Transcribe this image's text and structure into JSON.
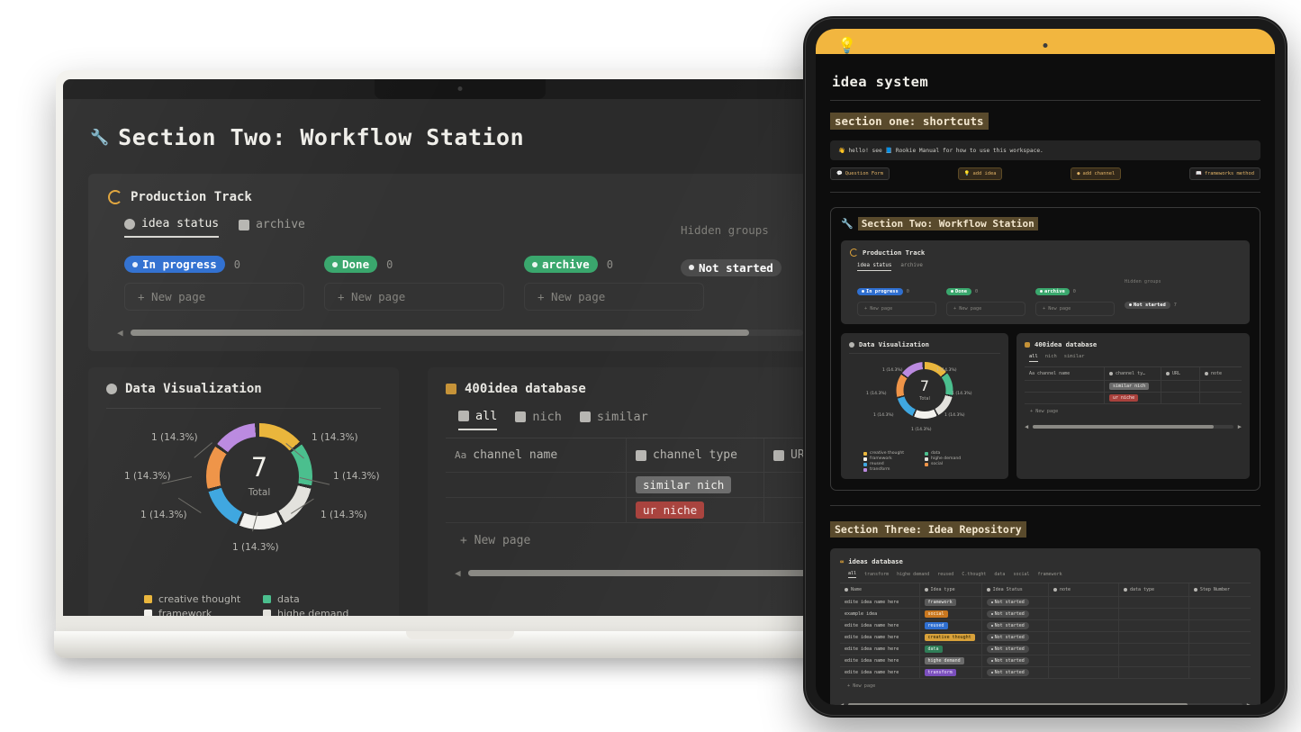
{
  "laptop": {
    "page_title": "Section Two: Workflow Station",
    "wrench_icon": "wrench-icon",
    "production": {
      "title": "Production Track",
      "tabs": [
        {
          "label": "idea status",
          "icon": "pie-icon",
          "active": true
        },
        {
          "label": "archive",
          "icon": "archive-icon",
          "active": false
        }
      ],
      "groups": [
        {
          "label": "In progress",
          "count": "0",
          "color": "#2f6fd0",
          "new_page": "+ New page"
        },
        {
          "label": "Done",
          "count": "0",
          "color": "#3aa76d",
          "new_page": "+ New page"
        },
        {
          "label": "archive",
          "count": "0",
          "color": "#3aa76d",
          "new_page": "+ New page"
        }
      ],
      "hidden_groups_label": "Hidden groups",
      "hidden_pill": {
        "label": "Not started",
        "count": "7",
        "color": "#4a4a4a"
      },
      "scroll_thumb_pct": 92
    },
    "data_viz": {
      "title": "Data Visualization",
      "icon": "clock-icon"
    },
    "database": {
      "title": "400idea database",
      "icon": "grid-yellow-icon",
      "tabs": [
        {
          "label": "all",
          "icon": "grid-icon",
          "active": true
        },
        {
          "label": "nich",
          "icon": "login-icon",
          "active": false
        },
        {
          "label": "similar",
          "icon": "logout-icon",
          "active": false
        }
      ],
      "columns": [
        {
          "label": "channel name",
          "icon": "Aa"
        },
        {
          "label": "channel type",
          "icon": "lock-icon"
        },
        {
          "label": "URL",
          "icon": "link-icon"
        },
        {
          "label": "note",
          "icon": "text-icon"
        }
      ],
      "rows": [
        {
          "name": "",
          "type": "similar nich",
          "type_bg": "#6b6b6b",
          "type_fg": "#f0efeb",
          "url": "",
          "note": ""
        },
        {
          "name": "",
          "type": "ur niche",
          "type_bg": "#a8413c",
          "type_fg": "#f6e9e8",
          "url": "",
          "note": ""
        }
      ],
      "new_page": "+ New page",
      "scroll_thumb_pct": 88
    }
  },
  "tablet": {
    "banner_icon": "lightbulb-icon",
    "h1": "idea system",
    "section_one": "section one: shortcuts",
    "callout": "hello! see 📘 Rookie Manual for how to use this workspace.",
    "callout_icon": "wave-icon",
    "buttons": [
      {
        "label": "Question Form",
        "icon": "speech-icon",
        "style": "plain"
      },
      {
        "label": "add idea",
        "icon": "bulb-icon",
        "style": "gold"
      },
      {
        "label": "add channel",
        "icon": "circle-icon",
        "style": "gold"
      },
      {
        "label": "frameworks method",
        "icon": "book-icon",
        "style": "plain"
      }
    ],
    "section_two": "Section Two: Workflow Station",
    "production": {
      "title": "Production Track",
      "tabs": [
        {
          "label": "idea status",
          "active": true
        },
        {
          "label": "archive",
          "active": false
        }
      ],
      "groups": [
        {
          "label": "In progress",
          "count": "0",
          "color": "#2f6fd0",
          "new_page": "+ New page"
        },
        {
          "label": "Done",
          "count": "0",
          "color": "#3aa76d",
          "new_page": "+ New page"
        },
        {
          "label": "archive",
          "count": "0",
          "color": "#3aa76d",
          "new_page": "+ New page"
        }
      ],
      "hidden_groups_label": "Hidden groups",
      "hidden_pill": {
        "label": "Not started",
        "count": "7"
      }
    },
    "data_viz_title": "Data Visualization",
    "database": {
      "title": "400idea database",
      "tabs": [
        {
          "label": "all",
          "active": true
        },
        {
          "label": "nich",
          "active": false
        },
        {
          "label": "similar",
          "active": false
        }
      ],
      "columns": [
        "channel name",
        "channel ty…",
        "URL",
        "note"
      ],
      "rows": [
        {
          "type": "similar nich",
          "type_bg": "#6b6b6b",
          "type_fg": "#f0efeb"
        },
        {
          "type": "ur niche",
          "type_bg": "#a8413c",
          "type_fg": "#f6e9e8"
        }
      ],
      "new_page": "+ New page"
    },
    "section_three": "Section Three: Idea Repository",
    "ideas": {
      "title": "ideas database",
      "icon": "infinity-icon",
      "tabs": [
        {
          "label": "all",
          "active": true
        },
        {
          "label": "transform",
          "active": false
        },
        {
          "label": "highe demand",
          "active": false
        },
        {
          "label": "reused",
          "active": false
        },
        {
          "label": "C.thought",
          "active": false
        },
        {
          "label": "data",
          "active": false
        },
        {
          "label": "social",
          "active": false
        },
        {
          "label": "framework",
          "active": false
        }
      ],
      "columns": [
        "Name",
        "Idea type",
        "Idea Status",
        "note",
        "data type",
        "Step Number"
      ],
      "rows": [
        {
          "name": "edite idea name here",
          "type": "framework",
          "type_bg": "#5a5a5a",
          "type_fg": "#ececea",
          "status": "Not started"
        },
        {
          "name": "example idea",
          "type": "social",
          "type_bg": "#c9771f",
          "type_fg": "#fff3e2",
          "status": "Not started"
        },
        {
          "name": "edite idea name here",
          "type": "reused",
          "type_bg": "#2f6fd0",
          "type_fg": "#eaf1fd",
          "status": "Not started"
        },
        {
          "name": "edite idea name here",
          "type": "creative thought",
          "type_bg": "#d8a13a",
          "type_fg": "#2a2103",
          "status": "Not started"
        },
        {
          "name": "edite idea name here",
          "type": "data",
          "type_bg": "#2f7d57",
          "type_fg": "#e6f5ec",
          "status": "Not started"
        },
        {
          "name": "edite idea name here",
          "type": "highe demand",
          "type_bg": "#6b6b6b",
          "type_fg": "#f0efeb",
          "status": "Not started"
        },
        {
          "name": "edite idea name here",
          "type": "transform",
          "type_bg": "#7b4fbd",
          "type_fg": "#f1e9fd",
          "status": "Not started"
        }
      ],
      "new_page": "+ New page"
    }
  },
  "chart_data": {
    "type": "pie",
    "title": "Data Visualization",
    "center_value": "7",
    "center_label": "Total",
    "categories": [
      "creative thought",
      "data",
      "highe demand",
      "framework",
      "reused",
      "social",
      "transform"
    ],
    "values": [
      1,
      1,
      1,
      1,
      1,
      1,
      1
    ],
    "percents": [
      14.3,
      14.3,
      14.3,
      14.3,
      14.3,
      14.3,
      14.3
    ],
    "data_labels": [
      "1 (14.3%)",
      "1 (14.3%)",
      "1 (14.3%)",
      "1 (14.3%)",
      "1 (14.3%)",
      "1 (14.3%)",
      "1 (14.3%)"
    ],
    "colors": [
      "#eab63c",
      "#4bbf8e",
      "#e3e2dd",
      "#f2f1ed",
      "#3fa7e0",
      "#ef9448",
      "#bb8ae0"
    ],
    "legend": [
      {
        "label": "creative thought",
        "color": "#eab63c"
      },
      {
        "label": "data",
        "color": "#4bbf8e"
      },
      {
        "label": "framework",
        "color": "#f2f1ed"
      },
      {
        "label": "highe demand",
        "color": "#e3e2dd"
      },
      {
        "label": "reused",
        "color": "#3fa7e0"
      },
      {
        "label": "social",
        "color": "#ef9448"
      },
      {
        "label": "transform",
        "color": "#bb8ae0"
      }
    ],
    "legend_position": "bottom",
    "donut": true
  }
}
